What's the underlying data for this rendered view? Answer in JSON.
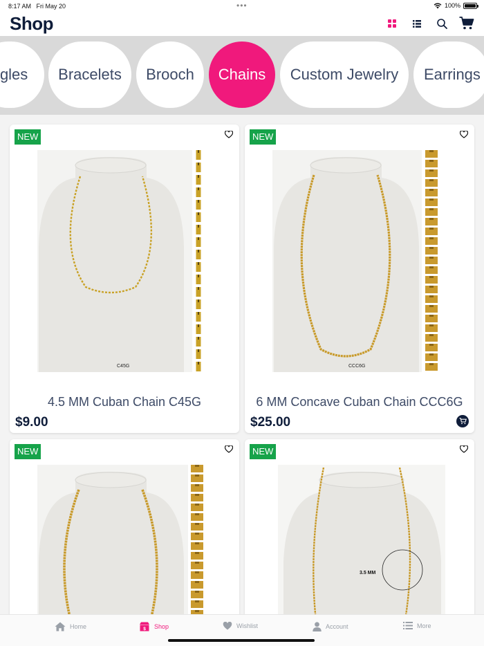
{
  "status": {
    "time": "8:17 AM",
    "date": "Fri May 20",
    "battery": "100%"
  },
  "header": {
    "title": "Shop"
  },
  "categories": [
    {
      "label": "ngles",
      "active": false
    },
    {
      "label": "Bracelets",
      "active": false
    },
    {
      "label": "Brooch",
      "active": false
    },
    {
      "label": "Chains",
      "active": true
    },
    {
      "label": "Custom Jewelry",
      "active": false
    },
    {
      "label": "Earrings",
      "active": false
    }
  ],
  "products": [
    {
      "badge": "NEW",
      "title": "4.5 MM Cuban Chain C45G",
      "price": "$9.00",
      "code": "C45G"
    },
    {
      "badge": "NEW",
      "title": "6 MM Concave Cuban Chain CCC6G",
      "price": "$25.00",
      "code": "CCC6G"
    },
    {
      "badge": "NEW",
      "title": "",
      "price": "",
      "code": ""
    },
    {
      "badge": "NEW",
      "title": "",
      "price": "",
      "code": "",
      "annotation": "3.5 MM"
    }
  ],
  "tabs": [
    {
      "label": "Home",
      "icon": "home-icon"
    },
    {
      "label": "Shop",
      "icon": "shop-icon"
    },
    {
      "label": "Wishlist",
      "icon": "heart-icon"
    },
    {
      "label": "Account",
      "icon": "user-icon"
    },
    {
      "label": "More",
      "icon": "list-icon"
    }
  ],
  "colors": {
    "accent": "#f0197c",
    "navy": "#0f1d3a",
    "badge": "#16a34a",
    "strip": "#d9d9d9"
  }
}
